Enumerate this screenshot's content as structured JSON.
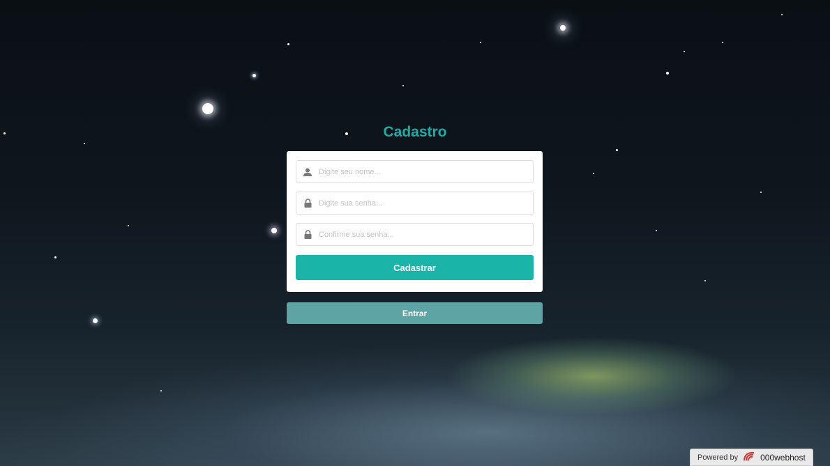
{
  "form": {
    "title": "Cadastro",
    "name_placeholder": "Digite seu nome...",
    "password_placeholder": "Digite sua senha...",
    "confirm_placeholder": "Confirme sua senha...",
    "submit_label": "Cadastrar"
  },
  "login_button_label": "Entrar",
  "footer": {
    "powered_by": "Powered by",
    "brand": "000webhost"
  },
  "colors": {
    "accent": "#1ab5a8",
    "secondary_button": "#5fa4a4",
    "title": "#1aada8"
  },
  "icons": [
    "user-icon",
    "lock-icon",
    "lock-icon",
    "webhost-logo-icon"
  ]
}
